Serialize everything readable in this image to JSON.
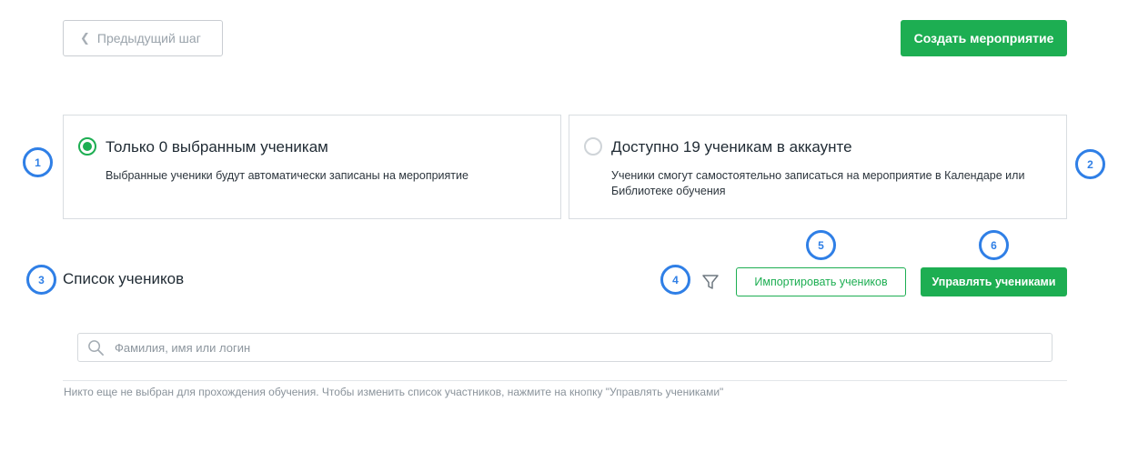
{
  "header": {
    "back_label": "Предыдущий шаг",
    "create_label": "Создать мероприятие"
  },
  "options": [
    {
      "title": "Только 0 выбранным ученикам",
      "description": "Выбранные ученики будут автоматически записаны на мероприятие",
      "selected": true
    },
    {
      "title": "Доступно 19 ученикам в аккаунте",
      "description": "Ученики смогут самостоятельно записаться на мероприятие в Календаре или Библиотеке обучения",
      "selected": false
    }
  ],
  "students": {
    "title": "Список учеников",
    "import_label": "Импортировать учеников",
    "manage_label": "Управлять учениками",
    "filter_icon": "filter-icon"
  },
  "search": {
    "placeholder": "Фамилия, имя или логин",
    "value": ""
  },
  "empty_note": "Никто еще не выбран для прохождения обучения. Чтобы изменить список участников, нажмите на кнопку \"Управлять учениками\"",
  "annotations": [
    "1",
    "2",
    "3",
    "4",
    "5",
    "6"
  ],
  "colors": {
    "accent_green": "#1dae52",
    "annotation_blue": "#2f7fe6"
  }
}
